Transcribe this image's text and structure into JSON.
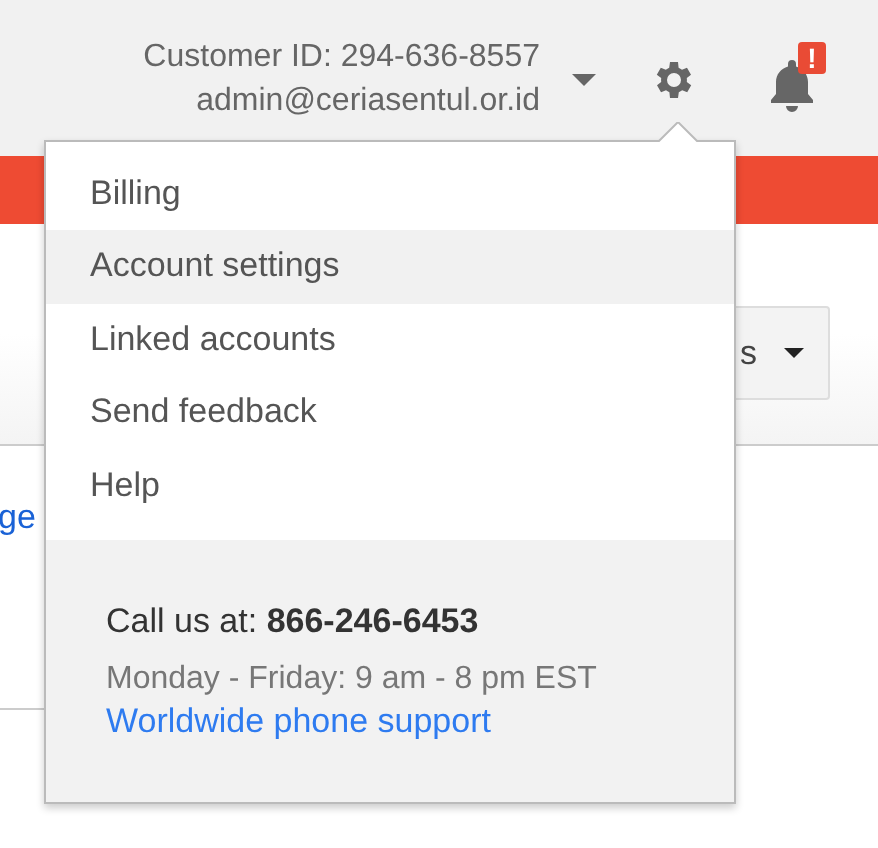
{
  "header": {
    "customer_id": "Customer ID: 294-636-8557",
    "email": "admin@ceriasentul.or.id",
    "notification_badge": "!"
  },
  "page": {
    "dropdown_label": "s",
    "link_text": "ge"
  },
  "menu": {
    "items": [
      {
        "label": "Billing",
        "selected": false
      },
      {
        "label": "Account settings",
        "selected": true
      },
      {
        "label": "Linked accounts",
        "selected": false
      },
      {
        "label": "Send feedback",
        "selected": false
      },
      {
        "label": "Help",
        "selected": false
      }
    ],
    "footer": {
      "call_text": "Call us at: **866-246-6453**",
      "hours": "Monday - Friday: 9 am - 8 pm EST",
      "link": "Worldwide phone support"
    }
  }
}
